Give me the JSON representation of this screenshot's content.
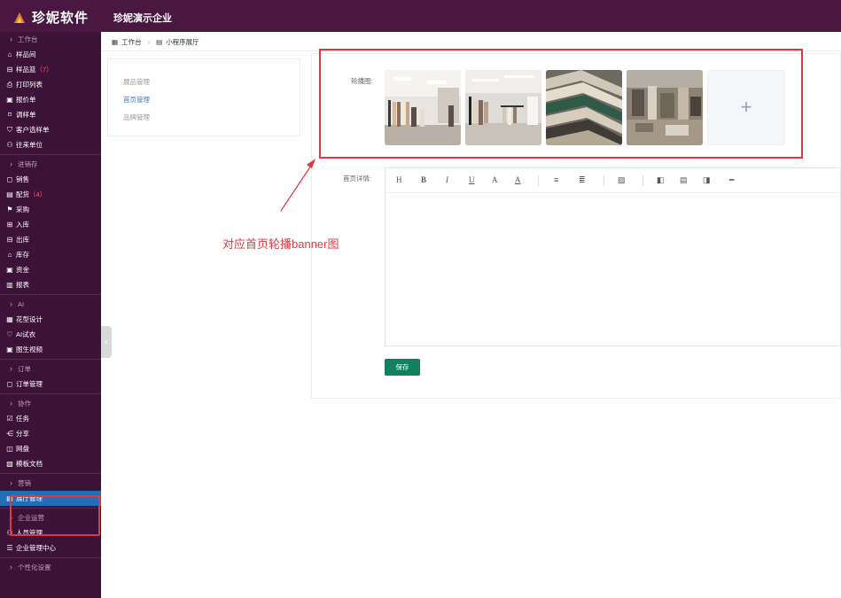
{
  "brand": {
    "name": "珍妮软件"
  },
  "header": {
    "company": "珍妮演示企业"
  },
  "breadcrumb": {
    "home": "工作台",
    "current": "小程序展厅"
  },
  "sidebar": {
    "groups": [
      {
        "title": "工作台",
        "items": [
          {
            "icon": "home-icon",
            "glyph": "⌂",
            "label": "样品间"
          },
          {
            "icon": "sample-box-icon",
            "glyph": "⊟",
            "label": "样品篮",
            "badge": "（7）"
          },
          {
            "icon": "printer-icon",
            "glyph": "⎙",
            "label": "打印列表"
          },
          {
            "icon": "quote-icon",
            "glyph": "▣",
            "label": "报价单"
          },
          {
            "icon": "tag-icon",
            "glyph": "⌑",
            "label": "调样单"
          },
          {
            "icon": "cart-icon",
            "glyph": "⛉",
            "label": "客户选样单"
          },
          {
            "icon": "contacts-icon",
            "glyph": "⚇",
            "label": "往来单位"
          }
        ]
      },
      {
        "title": "进销存",
        "items": [
          {
            "icon": "sales-icon",
            "glyph": "◻",
            "label": "销售"
          },
          {
            "icon": "allocate-icon",
            "glyph": "▤",
            "label": "配货",
            "badge": "（4）"
          },
          {
            "icon": "purchase-icon",
            "glyph": "⚑",
            "label": "采购"
          },
          {
            "icon": "stock-in-icon",
            "glyph": "⊞",
            "label": "入库"
          },
          {
            "icon": "stock-out-icon",
            "glyph": "⊟",
            "label": "出库"
          },
          {
            "icon": "warehouse-icon",
            "glyph": "⌂",
            "label": "库存"
          },
          {
            "icon": "funds-icon",
            "glyph": "▣",
            "label": "资金"
          },
          {
            "icon": "report-icon",
            "glyph": "▥",
            "label": "报表"
          }
        ]
      },
      {
        "title": "AI",
        "items": [
          {
            "icon": "pattern-design-icon",
            "glyph": "▦",
            "label": "花型设计"
          },
          {
            "icon": "tryon-icon",
            "glyph": "♡",
            "label": "AI试衣"
          },
          {
            "icon": "video-icon",
            "glyph": "▣",
            "label": "图生视频"
          }
        ]
      },
      {
        "title": "订单",
        "items": [
          {
            "icon": "order-icon",
            "glyph": "◻",
            "label": "订单管理"
          }
        ]
      },
      {
        "title": "协作",
        "items": [
          {
            "icon": "task-icon",
            "glyph": "☑",
            "label": "任务"
          },
          {
            "icon": "share-icon",
            "glyph": "⋲",
            "label": "分享"
          },
          {
            "icon": "disk-icon",
            "glyph": "◫",
            "label": "网盘"
          },
          {
            "icon": "template-icon",
            "glyph": "▧",
            "label": "模板文档"
          }
        ]
      },
      {
        "title": "营销",
        "items": [
          {
            "icon": "showroom-icon",
            "glyph": "▤",
            "label": "展厅管理",
            "active": true
          }
        ]
      },
      {
        "title": "企业运营",
        "items": [
          {
            "icon": "staff-icon",
            "glyph": "⚇",
            "label": "人员管理"
          },
          {
            "icon": "enterprise-icon",
            "glyph": "☰",
            "label": "企业管理中心"
          }
        ]
      },
      {
        "title": "个性化设置",
        "items": []
      }
    ]
  },
  "subnav": {
    "items": [
      "展品管理",
      "首页管理",
      "品牌管理"
    ],
    "active_index": 1
  },
  "form": {
    "banner_label": "轮播图:",
    "detail_label": "首页详情:",
    "add_symbol": "+",
    "save_label": "保存"
  },
  "editor_toolbar": {
    "buttons": [
      {
        "name": "heading-button",
        "glyph": "H"
      },
      {
        "name": "bold-button",
        "glyph": "B"
      },
      {
        "name": "italic-button",
        "glyph": "I"
      },
      {
        "name": "underline-button",
        "glyph": "U"
      },
      {
        "name": "font-color-button",
        "glyph": "A"
      },
      {
        "name": "background-color-button",
        "glyph": "A"
      },
      {
        "name": "ordered-list-button",
        "glyph": "≡"
      },
      {
        "name": "unordered-list-button",
        "glyph": "≣"
      },
      {
        "name": "image-button",
        "glyph": "▨"
      },
      {
        "name": "align-left-button",
        "glyph": "◧"
      },
      {
        "name": "align-center-button",
        "glyph": "▤"
      },
      {
        "name": "align-right-button",
        "glyph": "◨"
      },
      {
        "name": "divider-button",
        "glyph": "━"
      }
    ]
  },
  "annotation": {
    "text": "对应首页轮播banner图"
  },
  "colors": {
    "topbar": "#4a1743",
    "sidebar": "#3d1238",
    "active": "#1e6fb8",
    "annotation": "#e0383e",
    "save": "#10805e"
  }
}
